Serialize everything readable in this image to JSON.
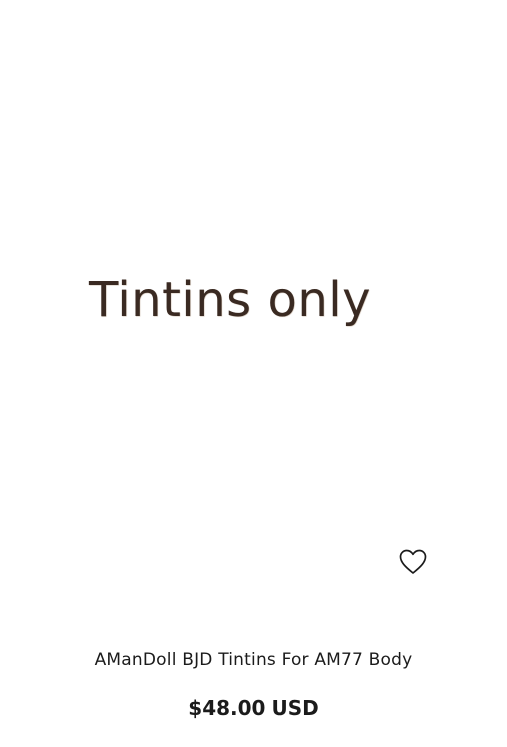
{
  "product": {
    "image_text": "Tintins only",
    "title": "AManDoll BJD Tintins For AM77 Body",
    "price": "$48.00",
    "currency": "USD",
    "wishlist_icon": "heart-outline-icon"
  },
  "colors": {
    "text": "#1b1b1b",
    "image_text": "#3a2a22",
    "background": "#ffffff"
  }
}
